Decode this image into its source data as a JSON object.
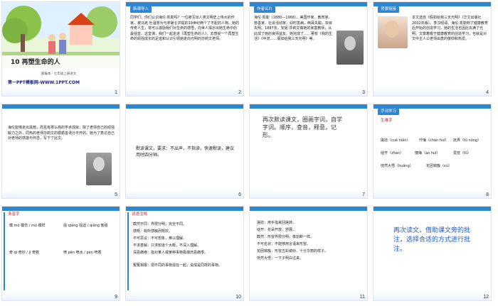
{
  "slides": [
    {
      "num": "1",
      "title": "10 再塑生命的人",
      "subtitle": "部编本 · 七年级上册语文",
      "footer": "第一PPT模板网-WWW.1PPT.COM"
    },
    {
      "num": "2",
      "badge": "新课导入",
      "body": "同学们，你们认识海伦·凯勒吗？一位被写出人类文明史上伟大的作家。被马克·吐温誉为与拿破仑并提的19世纪两个了不起的人物。她的传奇人生，将可以激励我们对生命的感悟，向世人揭示出她生命中的最强音。这堂课，我们一起走进《再塑生命的人》，去感受一个再塑生命的顽强成长的足迹和认识引领她走向光明的莎莉文老师。"
    },
    {
      "num": "3",
      "badge": "作者名片",
      "body": "海伦·凯勒（1880—1968），美国作家、教育家、慈善家、社会活动家。幼时患病，两耳失聪，双目失明。1887年，安妮·莎莉文做她的家庭教师，从此成了她的良师益友。她完成了……著有《我的生活》《中流……假如给我三天光明》等。"
    },
    {
      "num": "4",
      "badge": "背景链接",
      "body": "本文选自《假如给我三天光明》（华文出版社2002年版）。李汉昭译。海伦·凯勒到了健康教育后开始的创造学习，她的生活也因此充满了光明。文章着眼于健康教育的创造学习，也就是对文中主人公老师由衷的敬仰和热爱。"
    },
    {
      "num": "5",
      "body": "海伦能够走出黑暗，而且有那么高的学术成就，除了老师自己的顽强毅力之外，同热的老师莎莉文的循循善诱分不开的。她为了表达自己对老师的感激与怀念，写下了此文。"
    },
    {
      "num": "6",
      "body": "默读课文，要求：不出声，不指读，快速默读，建议用时四分钟。"
    },
    {
      "num": "7",
      "body": "再次默读课文，圈画字词，自学字词。顺序，查音，释意，记形。"
    },
    {
      "num": "8",
      "badge": "字词学习",
      "heading": "生难字",
      "words": [
        "搓捻（cuō niǎn）",
        "忏悔（chàn huǐ）",
        "抚弄（fǔ nòng）",
        "绽开（zhàn）",
        "懊悔（ào huǐ）",
        "爱抚（fǔ）",
        "恍然大悟（huǎng）",
        "花团锦簇（cù）"
      ]
    },
    {
      "num": "9",
      "heading": "多音字",
      "groups": [
        "模 mó 模仿 / mú 模样",
        "强 qiáng 强迫 / qiǎng 勉强",
        "奇 qí 奇妙 / jī 奇数",
        "喷 pēn 喷水 / pèn 喷香"
      ]
    },
    {
      "num": "10",
      "heading": "词语注释",
      "lines": [
        "截然不同：界限分明，完全不同。",
        "感慨：有所感触而慨叹。",
        "不可思议：不可想象，难以理解。",
        "不求甚解：只求知道个大概，不深入理解。",
        "深恶痛绝：指对某人或某种事物极端厌恶痛恨。",
        "冤冤相报：把不同的事物混在一起，说成是同样的事物。"
      ]
    },
    {
      "num": "11",
      "lines": [
        "搓捻：用手指来回搓转。",
        "绽开：花朵开放，舒展。",
        "截然：形容界限分明，像割断一样。",
        "不可名状：不能够用言语来形容。",
        "花团锦簇：形容五彩缤纷、十分华丽的样子。",
        "恍然大悟：一下子明白过来。"
      ]
    },
    {
      "num": "12",
      "body": "再次读文，借助课文旁的批注，选择合适的方式进行批注。"
    }
  ],
  "colors": {
    "accent": "#2e86d1",
    "teal": "#1f8aa3",
    "red": "#d02020"
  }
}
